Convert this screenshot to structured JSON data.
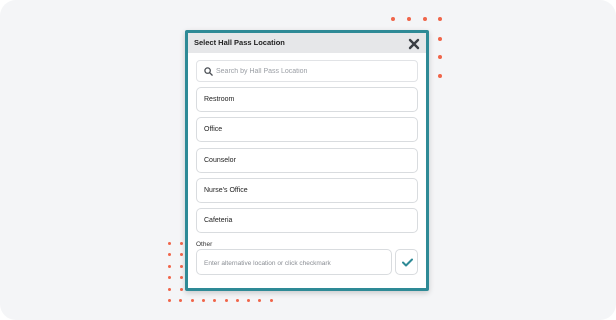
{
  "colors": {
    "accent": "#2e8a96",
    "dot": "#f0654a",
    "check": "#2e8a96"
  },
  "dialog": {
    "title": "Select Hall Pass Location",
    "close_icon": "close-icon"
  },
  "search": {
    "icon": "search-icon",
    "placeholder": "Search by Hall Pass Location",
    "value": ""
  },
  "locations": [
    {
      "label": "Restroom"
    },
    {
      "label": "Office"
    },
    {
      "label": "Counselor"
    },
    {
      "label": "Nurse's Office"
    },
    {
      "label": "Cafeteria"
    }
  ],
  "other": {
    "label": "Other",
    "placeholder": "Enter alternative location or click checkmark",
    "value": "",
    "confirm_icon": "checkmark-icon"
  }
}
